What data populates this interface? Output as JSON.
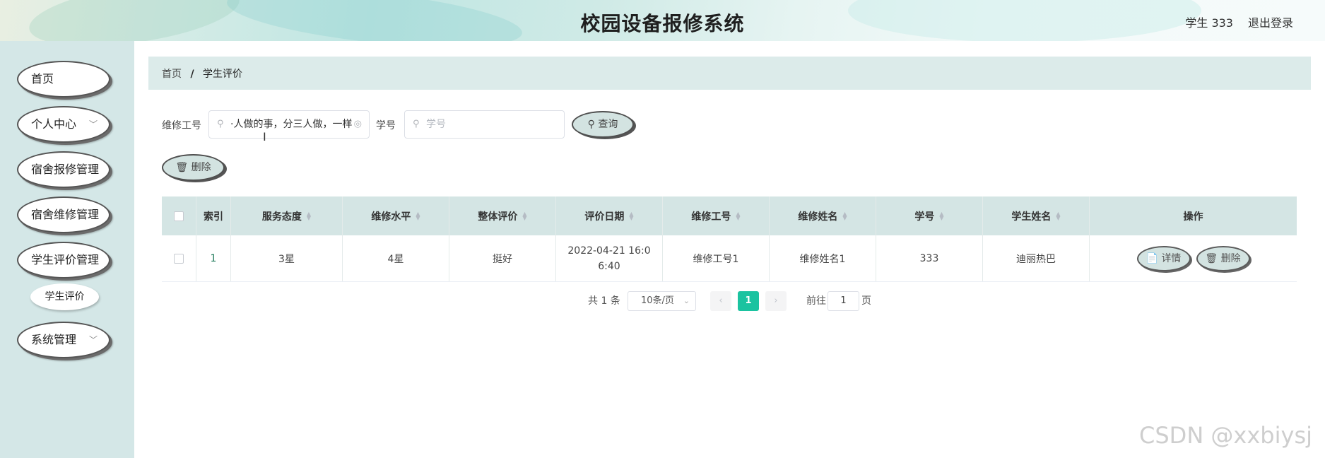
{
  "header": {
    "title": "校园设备报修系统",
    "user": "学生 333",
    "logout": "退出登录"
  },
  "sidebar": {
    "items": [
      {
        "label": "首页"
      },
      {
        "label": "个人中心",
        "chevron": "﹀"
      },
      {
        "label": "宿舍报修管理"
      },
      {
        "label": "宿舍维修管理"
      },
      {
        "label": "学生评价管理"
      },
      {
        "label": "系统管理",
        "chevron": "﹀"
      }
    ],
    "sub_items": [
      {
        "label": "学生评价"
      }
    ]
  },
  "breadcrumb": {
    "home": "首页",
    "separator": "/",
    "current": "学生评价"
  },
  "search": {
    "field1_label": "维修工号",
    "field1_value": "·人做的事，分三人做，一样",
    "field2_label": "学号",
    "field2_placeholder": "学号",
    "query_button": "查询"
  },
  "actions": {
    "delete_button": "删除"
  },
  "table": {
    "columns": [
      "索引",
      "服务态度",
      "维修水平",
      "整体评价",
      "评价日期",
      "维修工号",
      "维修姓名",
      "学号",
      "学生姓名",
      "操作"
    ],
    "rows": [
      {
        "index": "1",
        "service": "3星",
        "skill": "4星",
        "overall": "挺好",
        "date": "2022-04-21 16:06:40",
        "worker_id": "维修工号1",
        "worker_name": "维修姓名1",
        "student_id": "333",
        "student_name": "迪丽热巴",
        "detail_button": "详情",
        "delete_button": "删除"
      }
    ]
  },
  "pagination": {
    "total": "共 1 条",
    "page_size": "10条/页",
    "current_page": "1",
    "goto_label": "前往",
    "goto_value": "1",
    "page_suffix": "页"
  },
  "watermark": "CSDN @xxbiysj",
  "colors": {
    "sidebar_bg": "#d4e7e7",
    "table_header_bg": "#d4e5e4",
    "active_page": "#1bc3a0",
    "button_bg": "#d3e3e1"
  }
}
